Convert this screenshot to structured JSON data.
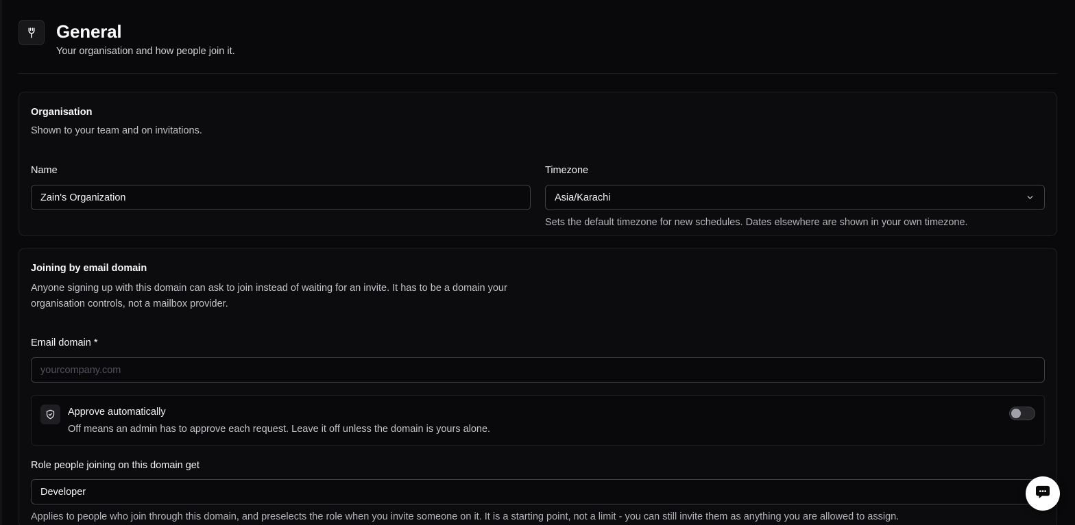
{
  "header": {
    "icon": "wrench-icon",
    "title": "General",
    "subtitle": "Your organisation and how people join it."
  },
  "organisation": {
    "title": "Organisation",
    "description": "Shown to your team and on invitations.",
    "name_label": "Name",
    "name_value": "Zain's Organization",
    "timezone_label": "Timezone",
    "timezone_value": "Asia/Karachi",
    "timezone_hint": "Sets the default timezone for new schedules. Dates elsewhere are shown in your own timezone."
  },
  "joining": {
    "title": "Joining by email domain",
    "description": "Anyone signing up with this domain can ask to join instead of waiting for an invite. It has to be a domain your organisation controls, not a mailbox provider.",
    "email_label": "Email domain *",
    "email_value": "",
    "email_placeholder": "yourcompany.com",
    "approve_icon": "shield-check-icon",
    "approve_title": "Approve automatically",
    "approve_desc": "Off means an admin has to approve each request. Leave it off unless the domain is yours alone.",
    "approve_enabled": false,
    "role_label": "Role people joining on this domain get",
    "role_value": "Developer",
    "role_hint": "Applies to people who join through this domain, and preselects the role when you invite someone on it. It is a starting point, not a limit - you can still invite them as anything you are allowed to assign."
  },
  "chat": {
    "icon": "chat-bubble-icon"
  }
}
